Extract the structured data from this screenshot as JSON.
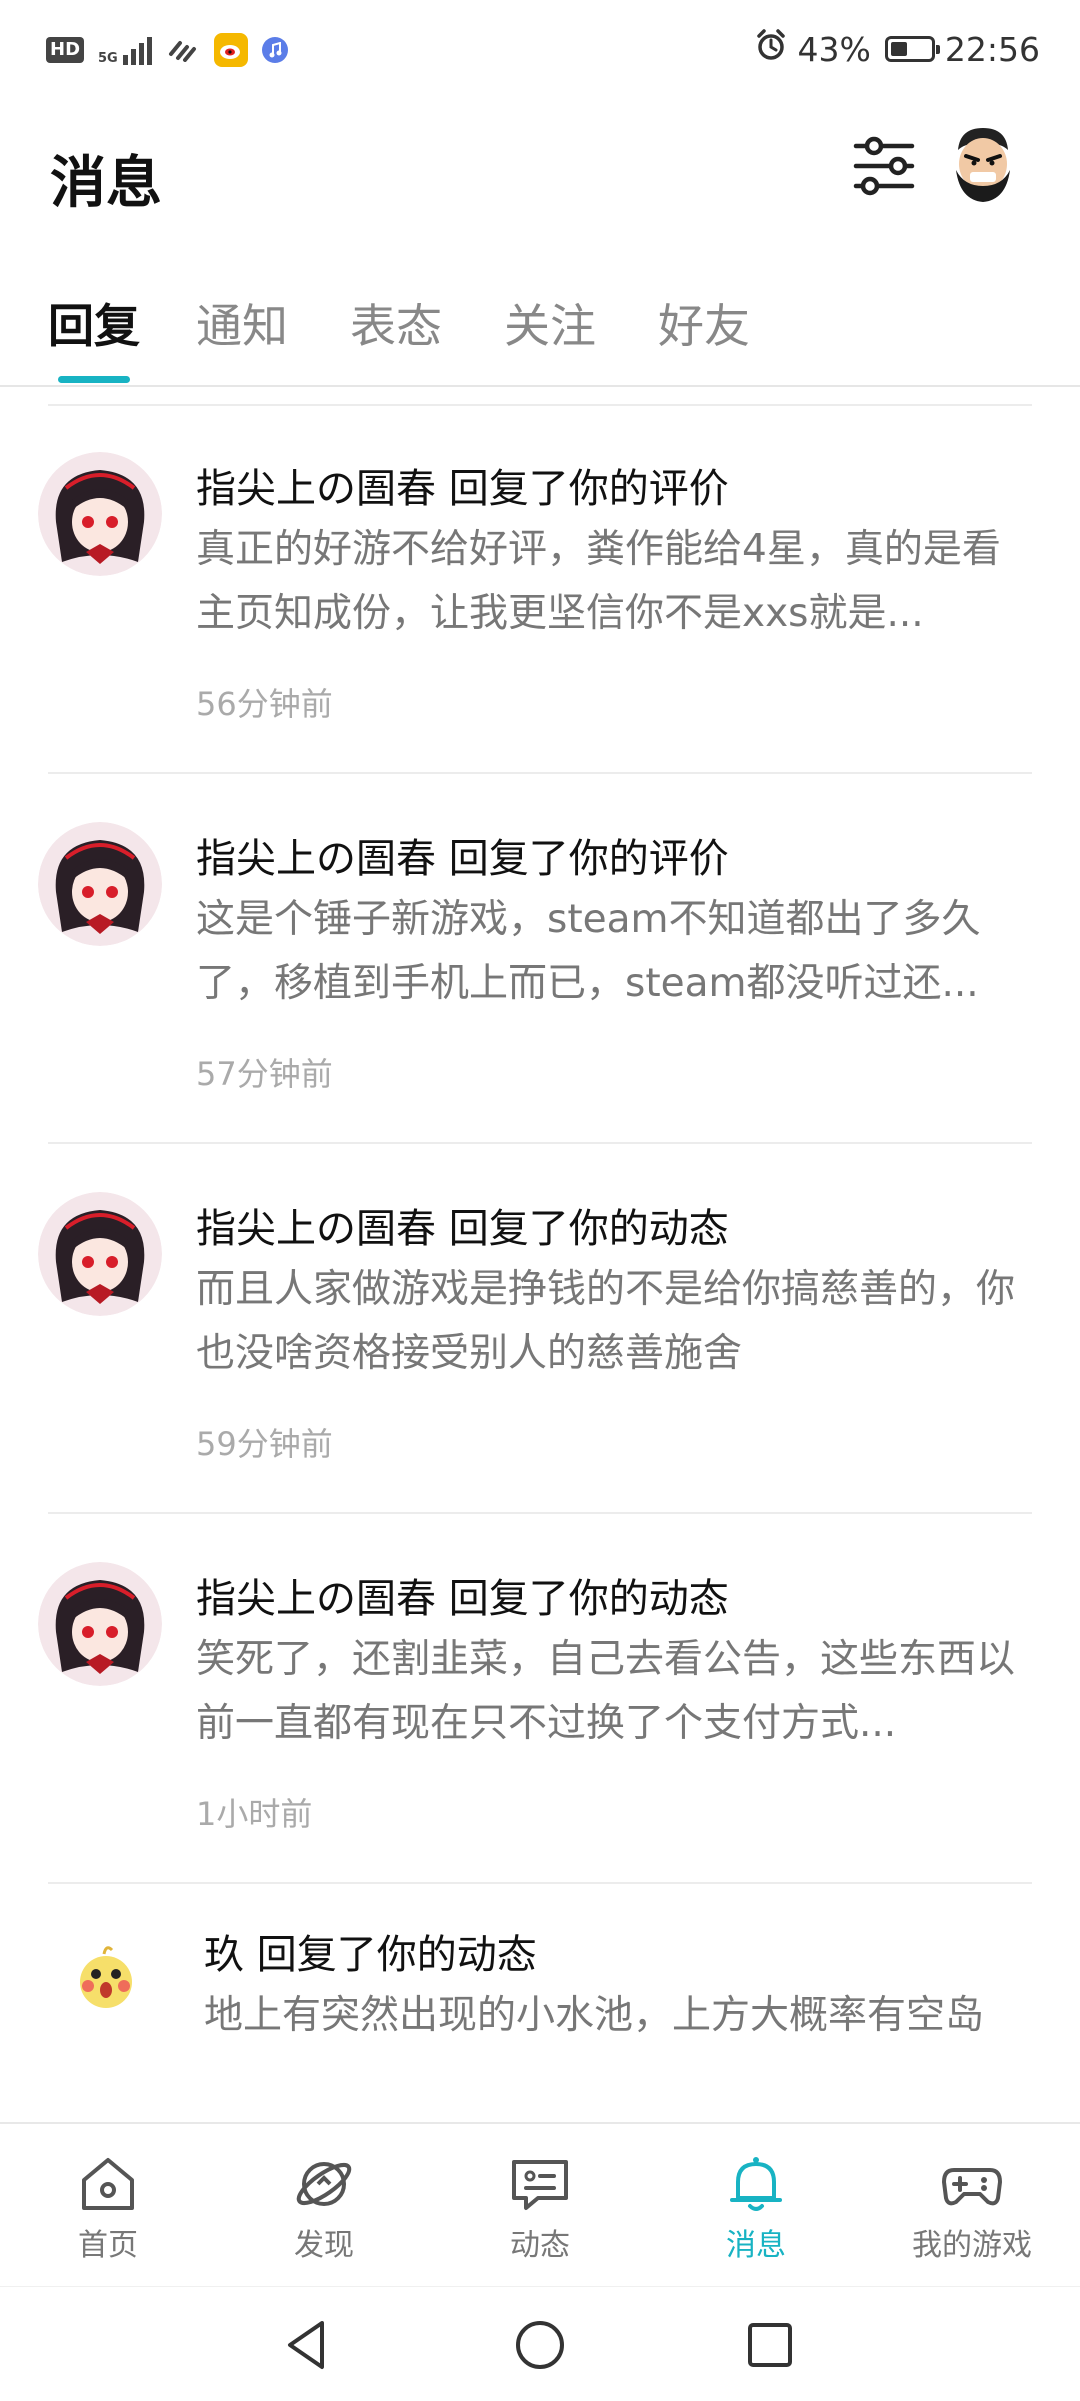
{
  "status_bar": {
    "hd": "HD",
    "network": "5G",
    "battery_percent": "43%",
    "battery_level": 0.43,
    "time": "22:56",
    "icons": [
      "hd-icon",
      "signal-icon",
      "link-icon",
      "weibo-icon",
      "music-icon",
      "alarm-icon",
      "battery-icon"
    ]
  },
  "header": {
    "title": "消息"
  },
  "tabs": [
    {
      "label": "回复",
      "active": true
    },
    {
      "label": "通知"
    },
    {
      "label": "表态"
    },
    {
      "label": "关注"
    },
    {
      "label": "好友"
    }
  ],
  "messages": [
    {
      "user": "指尖上の圄春",
      "action": "回复了你的评价",
      "title": "指尖上の圄春 回复了你的评价",
      "body": "真正的好游不给好评，粪作能给4星，真的是看主页知成份，让我更坚信你不是xxs就是...",
      "time": "56分钟前"
    },
    {
      "user": "指尖上の圄春",
      "action": "回复了你的评价",
      "title": "指尖上の圄春 回复了你的评价",
      "body": "这是个锤子新游戏，steam不知道都出了多久了，移植到手机上而已，steam都没听过还...",
      "time": "57分钟前"
    },
    {
      "user": "指尖上の圄春",
      "action": "回复了你的动态",
      "title": "指尖上の圄春 回复了你的动态",
      "body": "而且人家做游戏是挣钱的不是给你搞慈善的，你也没啥资格接受别人的慈善施舍",
      "time": "59分钟前"
    },
    {
      "user": "指尖上の圄春",
      "action": "回复了你的动态",
      "title": "指尖上の圄春 回复了你的动态",
      "body": "笑死了，还割韭菜，自己去看公告，这些东西以前一直都有现在只不过换了个支付方式...",
      "time": "1小时前"
    },
    {
      "user": "玖",
      "action": "回复了你的动态",
      "title": "玖 回复了你的动态",
      "body": "地上有突然出现的小水池，上方大概率有空岛",
      "time": ""
    }
  ],
  "bottom_nav": [
    {
      "label": "首页",
      "icon": "home-icon"
    },
    {
      "label": "发现",
      "icon": "discover-icon"
    },
    {
      "label": "动态",
      "icon": "feed-icon"
    },
    {
      "label": "消息",
      "icon": "bell-icon",
      "active": true
    },
    {
      "label": "我的游戏",
      "icon": "gamepad-icon"
    }
  ],
  "colors": {
    "accent": "#18b3c3",
    "text_primary": "#111111",
    "text_secondary": "#777777",
    "text_muted": "#aaaaaa"
  }
}
